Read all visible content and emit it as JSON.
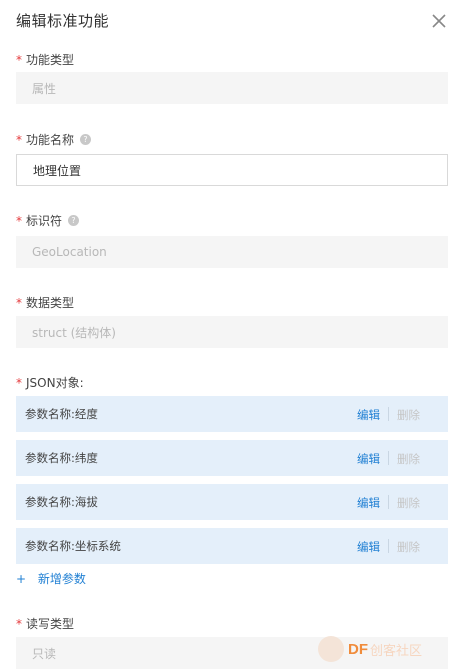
{
  "dialog": {
    "title": "编辑标准功能",
    "close_icon": "close-icon"
  },
  "form": {
    "required_mark": "*",
    "function_type": {
      "label": "功能类型",
      "value": "属性"
    },
    "function_name": {
      "label": "功能名称",
      "value": "地理位置",
      "help": "?"
    },
    "identifier": {
      "label": "标识符",
      "value": "GeoLocation",
      "help": "?"
    },
    "data_type": {
      "label": "数据类型",
      "value": "struct (结构体)"
    },
    "json_object": {
      "label": "JSON对象:"
    },
    "params": [
      {
        "label": "参数名称:经度",
        "edit": "编辑",
        "delete": "删除"
      },
      {
        "label": "参数名称:纬度",
        "edit": "编辑",
        "delete": "删除"
      },
      {
        "label": "参数名称:海拔",
        "edit": "编辑",
        "delete": "删除"
      },
      {
        "label": "参数名称:坐标系统",
        "edit": "编辑",
        "delete": "删除"
      }
    ],
    "add_param": {
      "icon": "+",
      "label": "新增参数"
    },
    "rw_type": {
      "label": "读写类型",
      "value": "只读"
    }
  },
  "watermark": {
    "logo": "DF",
    "text": "创客社区"
  },
  "colors": {
    "accent": "#1f7fd3",
    "required": "#e4393c",
    "param_bg": "#e4effa",
    "disabled_bg": "#f5f5f5"
  }
}
